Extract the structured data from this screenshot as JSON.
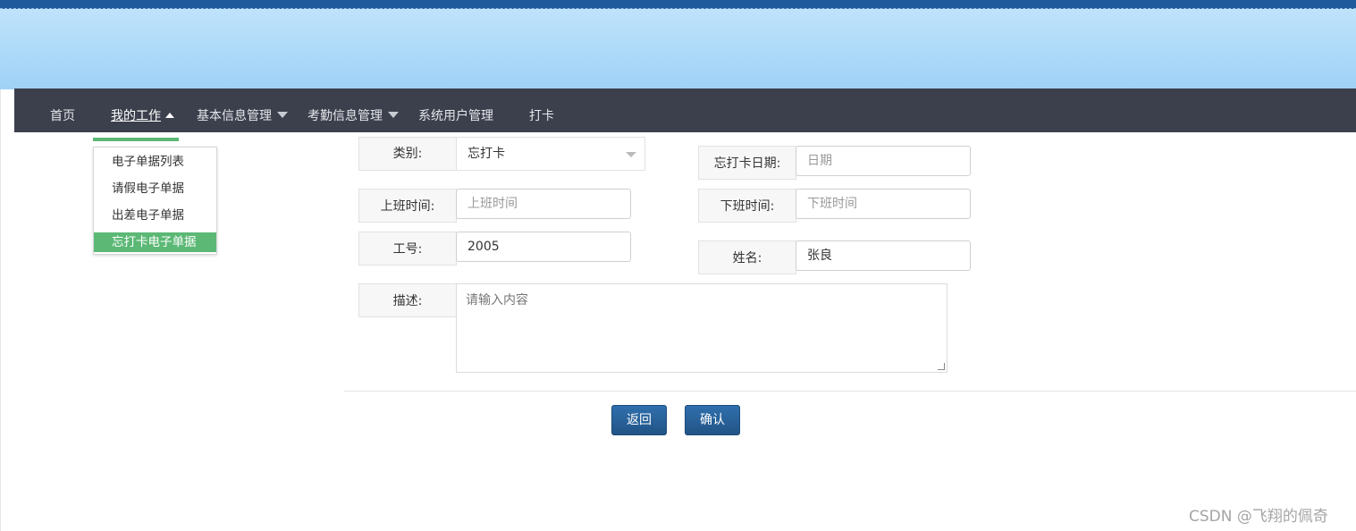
{
  "nav": {
    "home": "首页",
    "my_work": "我的工作",
    "basic_info": "基本信息管理",
    "attendance": "考勤信息管理",
    "system_users": "系统用户管理",
    "clock_in": "打卡"
  },
  "dropdown": {
    "items": [
      "电子单据列表",
      "请假电子单据",
      "出差电子单据",
      "忘打卡电子单据"
    ],
    "selected": "忘打卡电子单据"
  },
  "form": {
    "category_label": "类别:",
    "category_value": "忘打卡",
    "forgot_date_label": "忘打卡日期:",
    "forgot_date_placeholder": "日期",
    "start_time_label": "上班时间:",
    "start_time_placeholder": "上班时间",
    "end_time_label": "下班时间:",
    "end_time_placeholder": "下班时间",
    "employee_no_label": "工号:",
    "employee_no_value": "2005",
    "name_label": "姓名:",
    "name_value": "张良",
    "description_label": "描述:",
    "description_placeholder": "请输入内容"
  },
  "buttons": {
    "back": "返回",
    "confirm": "确认"
  },
  "watermark": "CSDN @飞翔的佩奇",
  "colors": {
    "navbar": "#3c404d",
    "accent_green": "#5cb875",
    "button_blue": "#2a63a0",
    "banner": "#b3dcf9"
  }
}
